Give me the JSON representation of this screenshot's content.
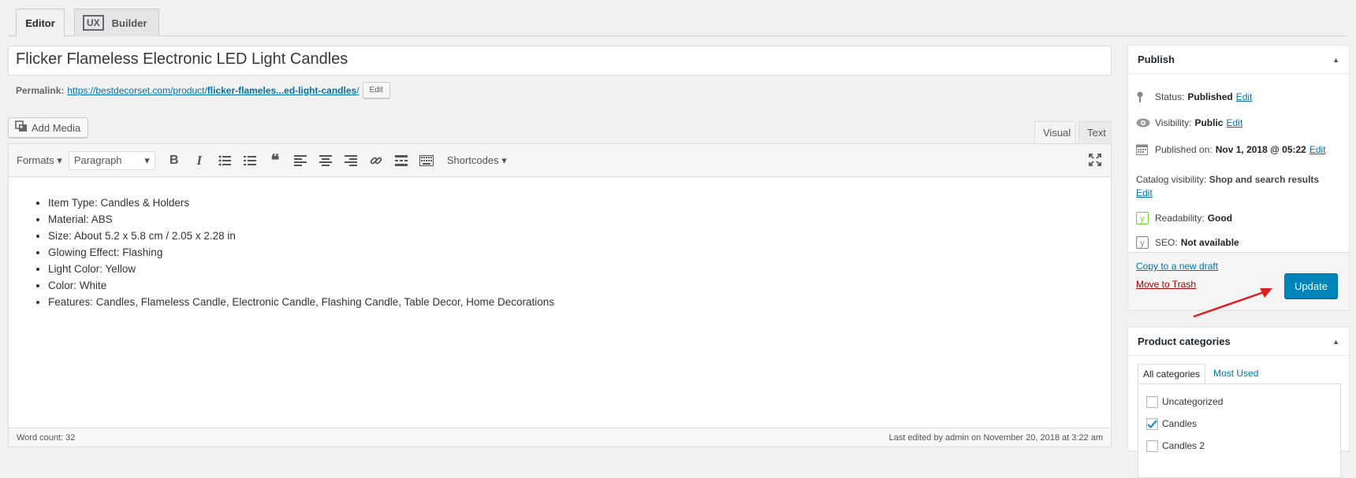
{
  "tabs": {
    "editor": "Editor",
    "ux": "UX",
    "builder": "Builder"
  },
  "post": {
    "title": "Flicker Flameless Electronic LED Light Candles",
    "permalink_label": "Permalink:",
    "permalink_base": "https://bestdecorset.com/product/",
    "permalink_slug": "flicker-flameles...ed-light-candles",
    "permalink_trail": "/",
    "edit_label": "Edit"
  },
  "media": {
    "add_label": "Add Media"
  },
  "modes": {
    "visual": "Visual",
    "text": "Text"
  },
  "toolbar": {
    "formats": "Formats",
    "paragraph": "Paragraph",
    "shortcodes": "Shortcodes"
  },
  "content": {
    "items": [
      "Item Type: Candles & Holders",
      "Material: ABS",
      "Size: About 5.2 x 5.8 cm / 2.05 x 2.28 in",
      "Glowing Effect: Flashing",
      "Light Color: Yellow",
      "Color: White",
      "Features: Candles, Flameless Candle, Electronic Candle, Flashing Candle, Table Decor, Home Decorations"
    ]
  },
  "status_bar": {
    "word_count": "Word count: 32",
    "last_edited": "Last edited by admin on November 20, 2018 at 3:22 am"
  },
  "publish": {
    "title": "Publish",
    "status_label": "Status:",
    "status_value": "Published",
    "visibility_label": "Visibility:",
    "visibility_value": "Public",
    "published_label": "Published on:",
    "published_value": "Nov 1, 2018 @ 05:22",
    "catalog_label": "Catalog visibility:",
    "catalog_value": "Shop and search results",
    "readability_label": "Readability:",
    "readability_value": "Good",
    "seo_label": "SEO:",
    "seo_value": "Not available",
    "edit": "Edit",
    "copy_draft": "Copy to a new draft",
    "trash": "Move to Trash",
    "update": "Update"
  },
  "categories": {
    "title": "Product categories",
    "tab_all": "All categories",
    "tab_most": "Most Used",
    "items": [
      {
        "label": "Uncategorized",
        "checked": false
      },
      {
        "label": "Candles",
        "checked": true
      },
      {
        "label": "Candles 2",
        "checked": false
      }
    ]
  },
  "colors": {
    "accent": "#0085ba",
    "link": "#0073aa",
    "trash": "#a00000",
    "arrow": "#e02020"
  }
}
